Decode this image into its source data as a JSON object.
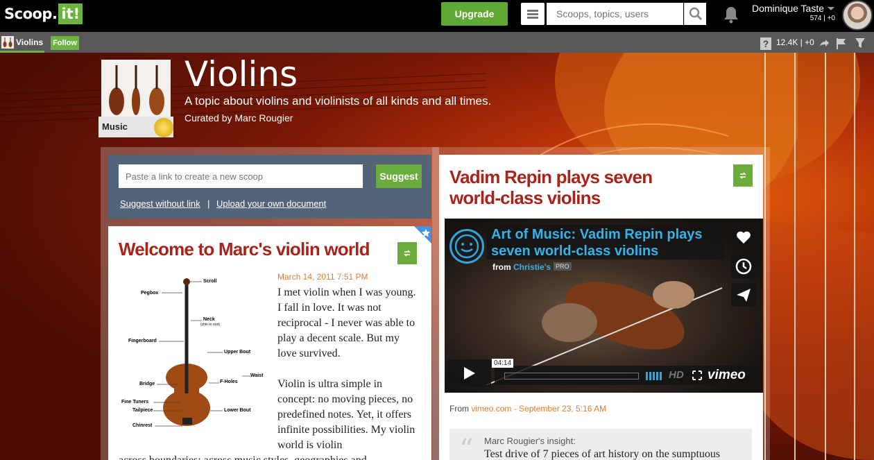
{
  "topbar": {
    "logo_text": "Scoop.",
    "logo_it": "it!",
    "upgrade_label": "Upgrade",
    "search_placeholder": "Scoops, topics, users",
    "user_name": "Dominique Taste",
    "user_stats": "574 | +0"
  },
  "subbar": {
    "topic_tab": "Violins",
    "follow_label": "Follow",
    "help_label": "?",
    "stats": "12.4K | +0"
  },
  "topic": {
    "title": "Violins",
    "description": "A topic about violins and violinists of all kinds and all times.",
    "curated_by": "Curated by Marc Rougier",
    "category_badge": "Music"
  },
  "suggest": {
    "input_placeholder": "Paste a link to create a new scoop",
    "button_label": "Suggest",
    "link_without": "Suggest without link",
    "separator": "|",
    "link_upload": "Upload your own document"
  },
  "post1": {
    "title": "Welcome to Marc's violin world",
    "date": "March 14, 2011 7:51 PM",
    "paragraph1": "I met violin when I was young. I fall in love. It was not reciprocal - I never was able to play a decent scale. But my love survived.",
    "paragraph2": "Violin is ultra simple in concept: no moving pieces, no predefined notes. Yet, it offers infinite possibilities. My violin world is violin",
    "paragraph2_tail": "across boundaries: across music styles, geographies and",
    "diagram_labels": [
      "Scroll",
      "Pegbox",
      "Neck",
      "(chin to root)",
      "Fingerboard",
      "Upper Bout",
      "Waist",
      "F-Holes",
      "Bridge",
      "Fine Tuners",
      "Tailpiece",
      "Lower Bout",
      "Chinrest"
    ]
  },
  "post2": {
    "title": "Vadim Repin plays seven world-class violins",
    "video_title": "Art of Music: Vadim Repin plays seven world-class violins",
    "video_from_prefix": "from",
    "video_from_channel": "Christie's",
    "video_badge": "PRO",
    "video_time": "04:14",
    "hd_label": "HD",
    "player_brand": "vimeo",
    "from_prefix": "From",
    "from_site": "vimeo.com",
    "from_date": " - September 23, 5:16 AM",
    "insight_heading": "Marc Rougier's insight:",
    "insight_text": "Test drive of 7 pieces of art history on the sumptuous"
  }
}
